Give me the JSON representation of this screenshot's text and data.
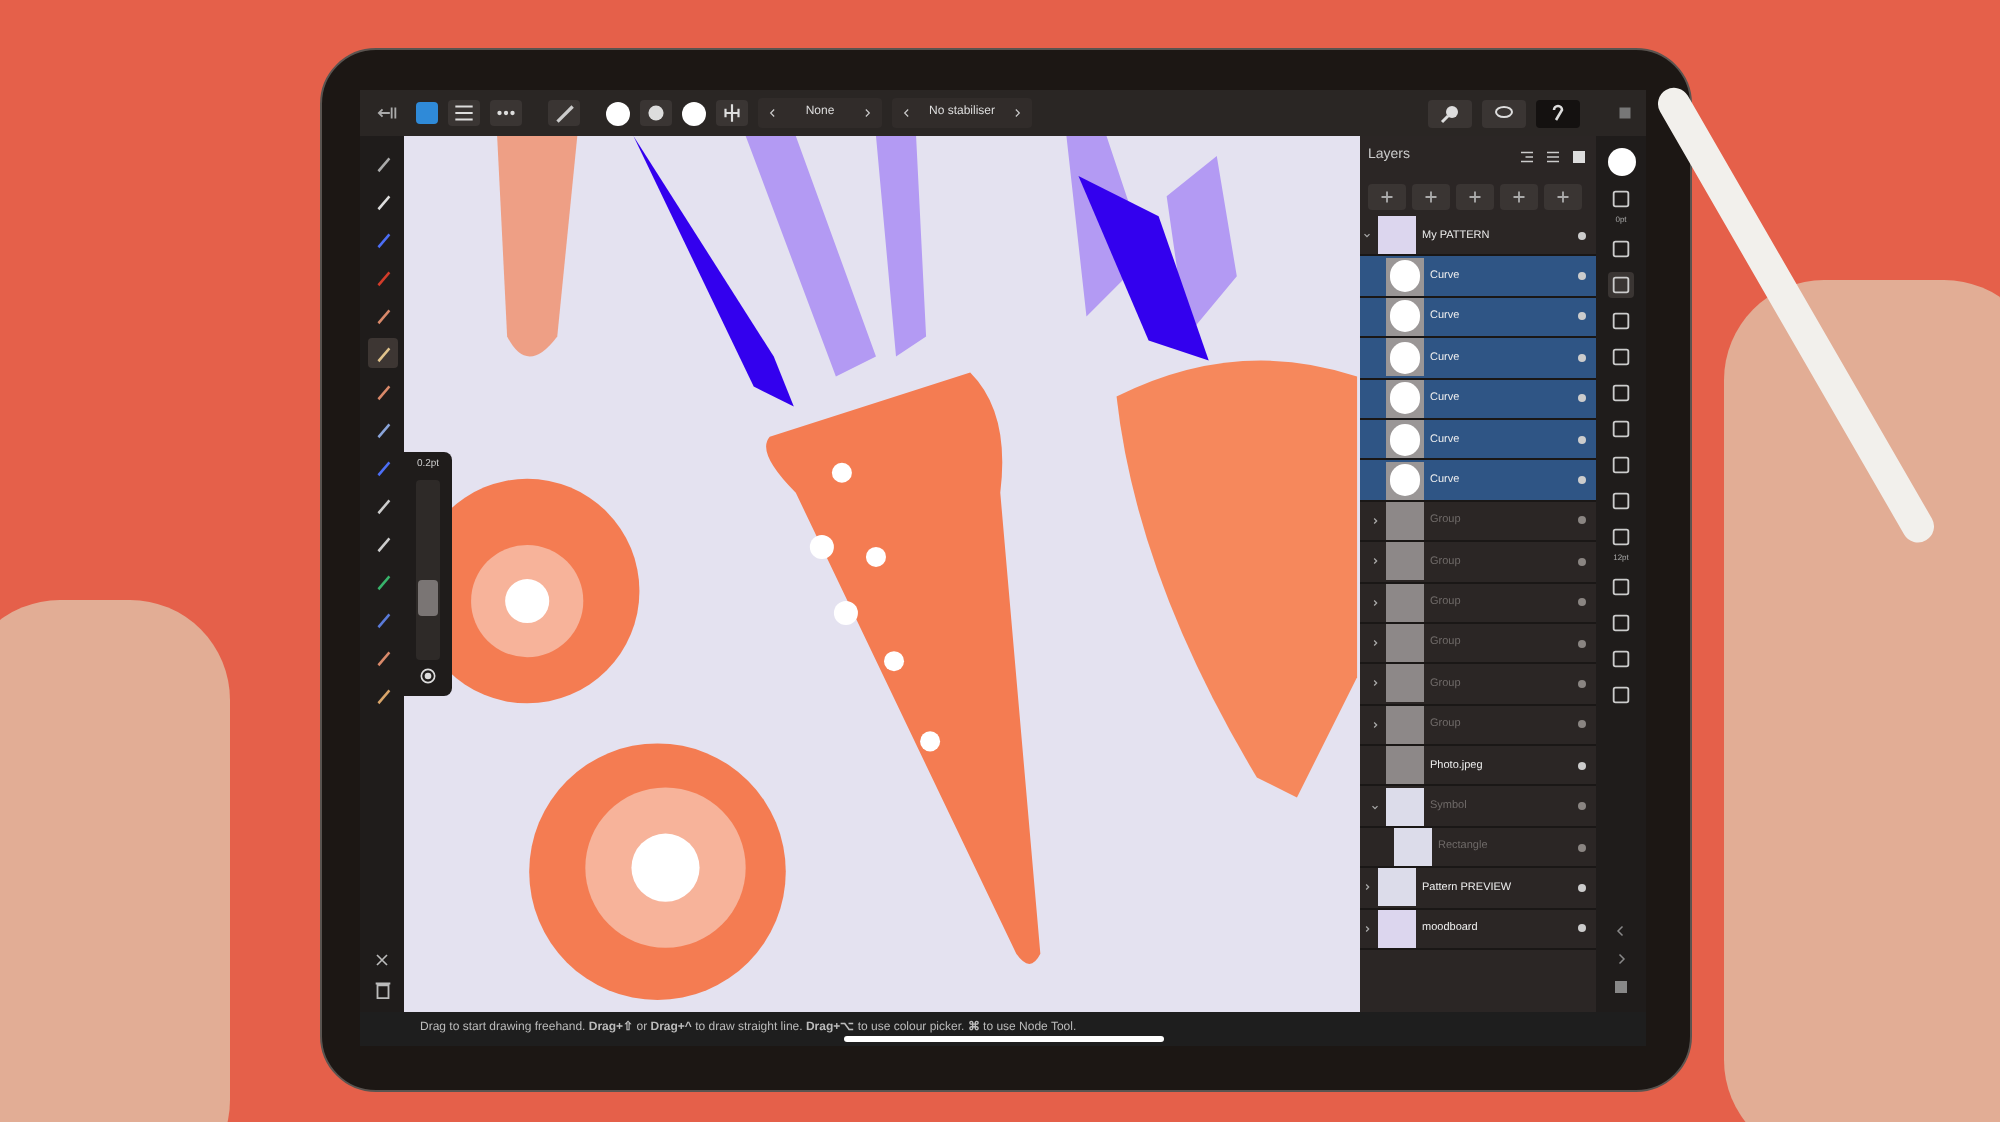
{
  "toolbar": {
    "selects": [
      {
        "value": "None"
      },
      {
        "value": "No stabiliser"
      }
    ],
    "right_tools": [
      {
        "selected": false
      },
      {
        "selected": false
      },
      {
        "selected": true
      }
    ]
  },
  "tools": [
    {
      "selected": false
    },
    {
      "selected": false
    },
    {
      "selected": false
    },
    {
      "selected": false
    },
    {
      "selected": false
    },
    {
      "selected": true
    },
    {
      "selected": false
    },
    {
      "selected": false
    },
    {
      "selected": false
    },
    {
      "selected": false
    },
    {
      "selected": false
    },
    {
      "selected": false
    },
    {
      "selected": false
    },
    {
      "selected": false
    },
    {
      "selected": false
    }
  ],
  "brush_width": {
    "reading": "0.2pt",
    "level": 0.3
  },
  "layers_panel": {
    "title": "Layers",
    "layers": [
      {
        "name": "My PATTERN",
        "kind": "pattern",
        "selected": false,
        "visible": true,
        "expanded": true,
        "children": [
          {
            "name": "Curve",
            "kind": "blob",
            "selected": true,
            "visible": true
          },
          {
            "name": "Curve",
            "kind": "blob",
            "selected": true,
            "visible": true
          },
          {
            "name": "Curve",
            "kind": "blob",
            "selected": true,
            "visible": true
          },
          {
            "name": "Curve",
            "kind": "blob",
            "selected": true,
            "visible": true
          },
          {
            "name": "Curve",
            "kind": "blob",
            "selected": true,
            "visible": true
          },
          {
            "name": "Curve",
            "kind": "blob",
            "selected": true,
            "visible": true
          },
          {
            "name": "Group",
            "kind": "checker",
            "selected": false,
            "visible": false,
            "expanded": false
          },
          {
            "name": "Group",
            "kind": "checker",
            "selected": false,
            "visible": false,
            "expanded": false
          },
          {
            "name": "Group",
            "kind": "checker",
            "selected": false,
            "visible": false,
            "expanded": false
          },
          {
            "name": "Group",
            "kind": "checker",
            "selected": false,
            "visible": false,
            "expanded": false
          },
          {
            "name": "Group",
            "kind": "checker",
            "selected": false,
            "visible": false,
            "expanded": false
          },
          {
            "name": "Group",
            "kind": "checker",
            "selected": false,
            "visible": false,
            "expanded": false
          },
          {
            "name": "Photo.jpeg",
            "kind": "checker",
            "selected": false,
            "visible": true
          },
          {
            "name": "Symbol",
            "kind": "plain",
            "selected": false,
            "visible": false,
            "expanded": true,
            "children": [
              {
                "name": "Rectangle",
                "kind": "plain",
                "selected": false,
                "visible": false
              }
            ]
          }
        ]
      },
      {
        "name": "Pattern PREVIEW",
        "kind": "plain",
        "selected": false,
        "visible": true,
        "expanded": false
      },
      {
        "name": "moodboard",
        "kind": "pattern",
        "selected": false,
        "visible": true,
        "expanded": false
      }
    ]
  },
  "side_labels": [
    "0pt",
    "12pt"
  ],
  "status_bar": "Drag to start drawing freehand. **Drag+⇧** or **Drag+^** to draw straight line. **Drag+⌥** to use colour picker. **⌘** to use Node Tool."
}
